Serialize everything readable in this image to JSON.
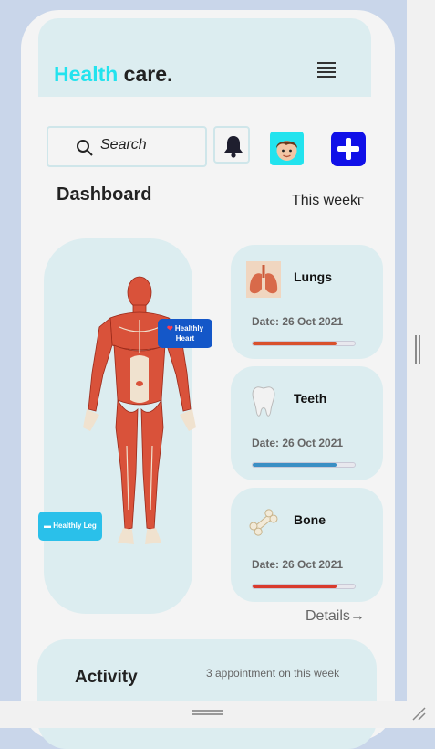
{
  "header": {
    "brand_accent": "Health",
    "brand_rest": " care."
  },
  "search": {
    "placeholder": "Search"
  },
  "dashboard": {
    "title": "Dashboard",
    "period": "This weekⲅ"
  },
  "body_tags": {
    "heart": "Healthly Heart",
    "leg": "Healthly Leg"
  },
  "organs": [
    {
      "name": "Lungs",
      "date": "Date: 26 Oct 2021",
      "progress": 0.82,
      "color": "#d9512c",
      "icon": "lungs-icon"
    },
    {
      "name": "Teeth",
      "date": "Date: 26 Oct 2021",
      "progress": 0.82,
      "color": "#3a8fc4",
      "icon": "tooth-icon"
    },
    {
      "name": "Bone",
      "date": "Date: 26 Oct 2021",
      "progress": 0.82,
      "color": "#d93a2c",
      "icon": "bone-icon"
    }
  ],
  "details_link": "Details→",
  "activity": {
    "title": "Activity",
    "subtitle": "3 appointment on this week"
  },
  "colors": {
    "accent": "#22e3ee",
    "plus_button": "#1010e8",
    "panel": "#dcedf0"
  }
}
